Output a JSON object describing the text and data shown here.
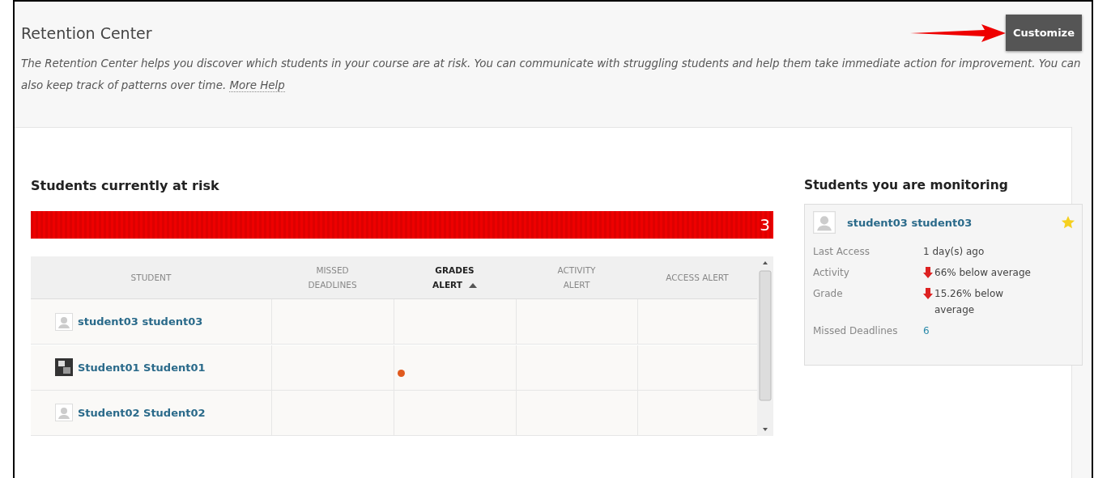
{
  "page": {
    "title": "Retention Center",
    "description": "The Retention Center helps you discover which students in your course are at risk. You can communicate with struggling students and help them take immediate action for improvement. You can also keep track of patterns over time.",
    "help_link": "More Help",
    "customize_button": "Customize"
  },
  "at_risk": {
    "title": "Students currently at risk",
    "count": "3",
    "level": 1,
    "columns": [
      {
        "label": "STUDENT",
        "sorted": false
      },
      {
        "label": "MISSED DEADLINES",
        "sorted": false
      },
      {
        "label": "GRADES ALERT",
        "sorted": true
      },
      {
        "label": "ACTIVITY ALERT",
        "sorted": false
      },
      {
        "label": "ACCESS ALERT",
        "sorted": false
      }
    ],
    "rows": [
      {
        "name": "student03 student03",
        "kind": "default",
        "grades_alert": false
      },
      {
        "name": "Student01 Student01",
        "kind": "photo",
        "grades_alert": true
      },
      {
        "name": "Student02 Student02",
        "kind": "default",
        "grades_alert": false
      }
    ]
  },
  "monitoring": {
    "title": "Students you are monitoring",
    "students": [
      {
        "name": "student03 student03",
        "starred": true,
        "fields": [
          {
            "label": "Last Access",
            "value": "1 day(s) ago",
            "kind": "text"
          },
          {
            "label": "Activity",
            "value": "66% below average",
            "kind": "down"
          },
          {
            "label": "Grade",
            "value": "15.26% below average",
            "kind": "down"
          },
          {
            "label": "Missed Deadlines",
            "value": "6",
            "kind": "link"
          }
        ]
      }
    ]
  }
}
